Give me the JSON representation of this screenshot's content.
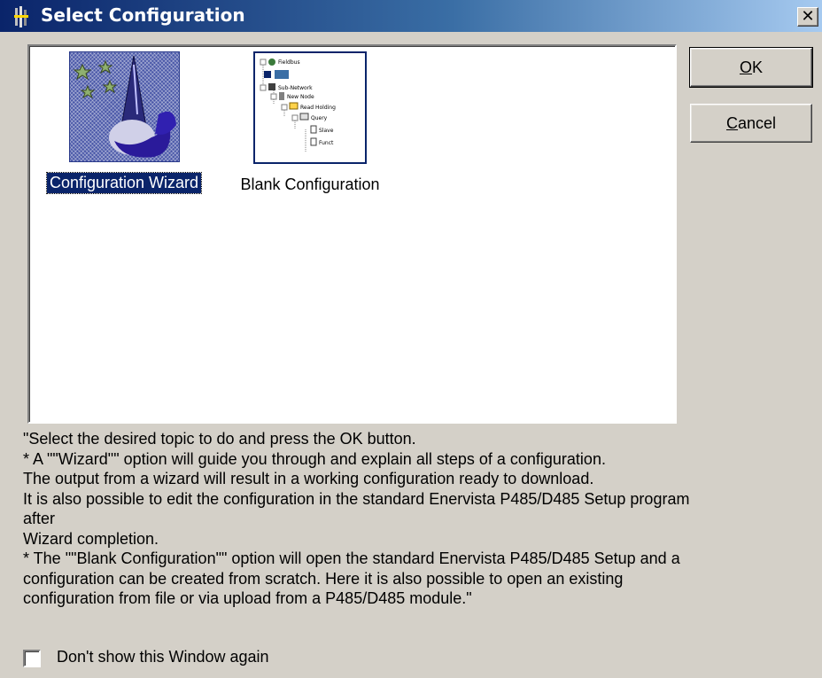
{
  "window": {
    "title": "Select Configuration",
    "close_glyph": "✕"
  },
  "icons": {
    "app": "app-icon",
    "wizard": "wizard-image",
    "blank": "tree-view-thumbnail",
    "close": "close-icon"
  },
  "items": [
    {
      "label": "Configuration Wizard",
      "selected": true
    },
    {
      "label": "Blank Configuration",
      "selected": false
    }
  ],
  "thumbnail_tree": [
    "Fieldbus",
    "",
    "Sub-Network",
    "New Node",
    "Read Holding",
    "Query",
    "Slave",
    "Funct"
  ],
  "buttons": {
    "ok_mn": "O",
    "ok_rest": "K",
    "cancel_mn": "C",
    "cancel_rest": "ancel"
  },
  "description": [
    "\"Select the desired topic to do and press the OK button.",
    "* A \"\"Wizard\"\" option will guide you through and explain all steps of  a configuration.",
    "The output from a wizard will result in a working configuration ready to download.",
    "It is also possible to edit the configuration in the standard Enervista P485/D485 Setup program",
    "after",
    "Wizard completion.",
    "* The \"\"Blank Configuration\"\" option will open the standard Enervista P485/D485 Setup and a",
    "configuration can be created from scratch. Here it is also possible to open an existing",
    "configuration from file or via upload from a P485/D485 module.\""
  ],
  "checkbox": {
    "label": "Don't show this Window again",
    "checked": false
  },
  "colors": {
    "title_start": "#0a246a",
    "title_end": "#a6caf0",
    "selection": "#0a246a",
    "face": "#d4d0c8"
  }
}
